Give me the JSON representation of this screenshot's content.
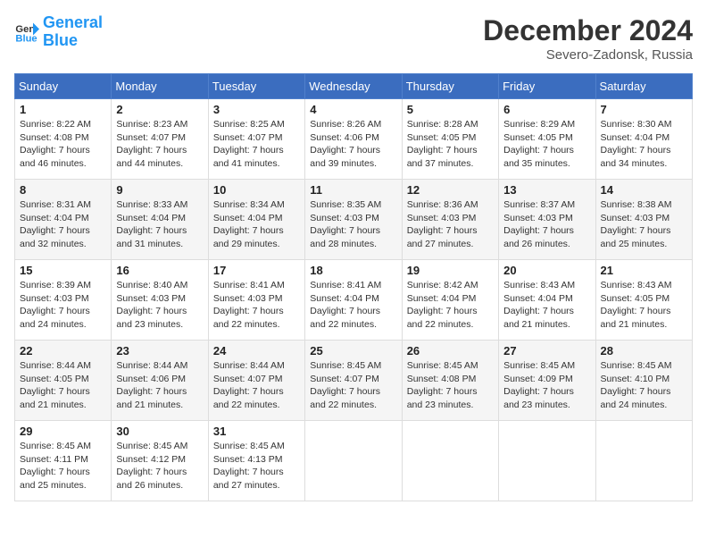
{
  "logo": {
    "line1": "General",
    "line2": "Blue"
  },
  "title": "December 2024",
  "subtitle": "Severo-Zadonsk, Russia",
  "weekdays": [
    "Sunday",
    "Monday",
    "Tuesday",
    "Wednesday",
    "Thursday",
    "Friday",
    "Saturday"
  ],
  "weeks": [
    [
      {
        "day": "1",
        "sunrise": "8:22 AM",
        "sunset": "4:08 PM",
        "daylight": "7 hours and 46 minutes."
      },
      {
        "day": "2",
        "sunrise": "8:23 AM",
        "sunset": "4:07 PM",
        "daylight": "7 hours and 44 minutes."
      },
      {
        "day": "3",
        "sunrise": "8:25 AM",
        "sunset": "4:07 PM",
        "daylight": "7 hours and 41 minutes."
      },
      {
        "day": "4",
        "sunrise": "8:26 AM",
        "sunset": "4:06 PM",
        "daylight": "7 hours and 39 minutes."
      },
      {
        "day": "5",
        "sunrise": "8:28 AM",
        "sunset": "4:05 PM",
        "daylight": "7 hours and 37 minutes."
      },
      {
        "day": "6",
        "sunrise": "8:29 AM",
        "sunset": "4:05 PM",
        "daylight": "7 hours and 35 minutes."
      },
      {
        "day": "7",
        "sunrise": "8:30 AM",
        "sunset": "4:04 PM",
        "daylight": "7 hours and 34 minutes."
      }
    ],
    [
      {
        "day": "8",
        "sunrise": "8:31 AM",
        "sunset": "4:04 PM",
        "daylight": "7 hours and 32 minutes."
      },
      {
        "day": "9",
        "sunrise": "8:33 AM",
        "sunset": "4:04 PM",
        "daylight": "7 hours and 31 minutes."
      },
      {
        "day": "10",
        "sunrise": "8:34 AM",
        "sunset": "4:04 PM",
        "daylight": "7 hours and 29 minutes."
      },
      {
        "day": "11",
        "sunrise": "8:35 AM",
        "sunset": "4:03 PM",
        "daylight": "7 hours and 28 minutes."
      },
      {
        "day": "12",
        "sunrise": "8:36 AM",
        "sunset": "4:03 PM",
        "daylight": "7 hours and 27 minutes."
      },
      {
        "day": "13",
        "sunrise": "8:37 AM",
        "sunset": "4:03 PM",
        "daylight": "7 hours and 26 minutes."
      },
      {
        "day": "14",
        "sunrise": "8:38 AM",
        "sunset": "4:03 PM",
        "daylight": "7 hours and 25 minutes."
      }
    ],
    [
      {
        "day": "15",
        "sunrise": "8:39 AM",
        "sunset": "4:03 PM",
        "daylight": "7 hours and 24 minutes."
      },
      {
        "day": "16",
        "sunrise": "8:40 AM",
        "sunset": "4:03 PM",
        "daylight": "7 hours and 23 minutes."
      },
      {
        "day": "17",
        "sunrise": "8:41 AM",
        "sunset": "4:03 PM",
        "daylight": "7 hours and 22 minutes."
      },
      {
        "day": "18",
        "sunrise": "8:41 AM",
        "sunset": "4:04 PM",
        "daylight": "7 hours and 22 minutes."
      },
      {
        "day": "19",
        "sunrise": "8:42 AM",
        "sunset": "4:04 PM",
        "daylight": "7 hours and 22 minutes."
      },
      {
        "day": "20",
        "sunrise": "8:43 AM",
        "sunset": "4:04 PM",
        "daylight": "7 hours and 21 minutes."
      },
      {
        "day": "21",
        "sunrise": "8:43 AM",
        "sunset": "4:05 PM",
        "daylight": "7 hours and 21 minutes."
      }
    ],
    [
      {
        "day": "22",
        "sunrise": "8:44 AM",
        "sunset": "4:05 PM",
        "daylight": "7 hours and 21 minutes."
      },
      {
        "day": "23",
        "sunrise": "8:44 AM",
        "sunset": "4:06 PM",
        "daylight": "7 hours and 21 minutes."
      },
      {
        "day": "24",
        "sunrise": "8:44 AM",
        "sunset": "4:07 PM",
        "daylight": "7 hours and 22 minutes."
      },
      {
        "day": "25",
        "sunrise": "8:45 AM",
        "sunset": "4:07 PM",
        "daylight": "7 hours and 22 minutes."
      },
      {
        "day": "26",
        "sunrise": "8:45 AM",
        "sunset": "4:08 PM",
        "daylight": "7 hours and 23 minutes."
      },
      {
        "day": "27",
        "sunrise": "8:45 AM",
        "sunset": "4:09 PM",
        "daylight": "7 hours and 23 minutes."
      },
      {
        "day": "28",
        "sunrise": "8:45 AM",
        "sunset": "4:10 PM",
        "daylight": "7 hours and 24 minutes."
      }
    ],
    [
      {
        "day": "29",
        "sunrise": "8:45 AM",
        "sunset": "4:11 PM",
        "daylight": "7 hours and 25 minutes."
      },
      {
        "day": "30",
        "sunrise": "8:45 AM",
        "sunset": "4:12 PM",
        "daylight": "7 hours and 26 minutes."
      },
      {
        "day": "31",
        "sunrise": "8:45 AM",
        "sunset": "4:13 PM",
        "daylight": "7 hours and 27 minutes."
      },
      null,
      null,
      null,
      null
    ]
  ]
}
